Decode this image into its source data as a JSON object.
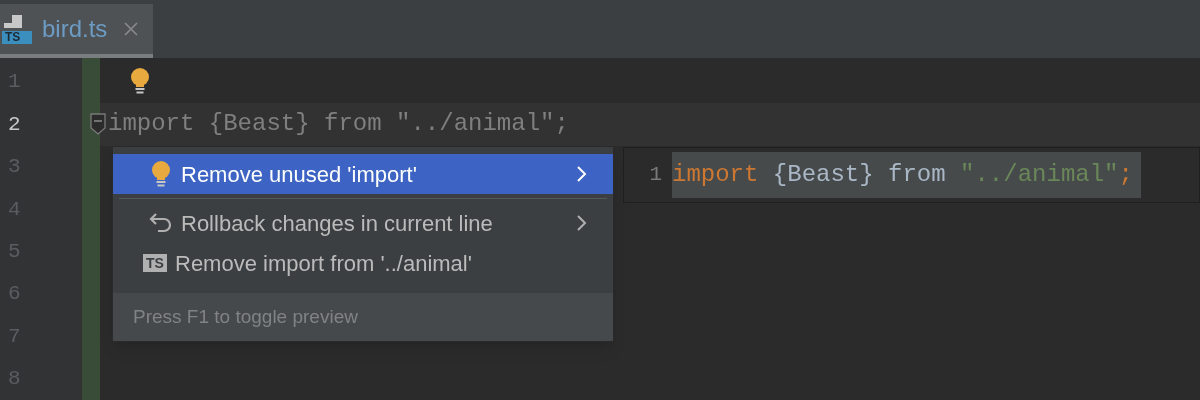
{
  "tabs": [
    {
      "label": "bird.ts",
      "badge": "TS",
      "selected": true
    }
  ],
  "gutter": {
    "line_numbers": [
      {
        "text": "1",
        "current": false
      },
      {
        "text": "2",
        "current": true
      },
      {
        "text": "3",
        "current": false
      },
      {
        "text": "4",
        "current": false
      },
      {
        "text": "5",
        "current": false
      },
      {
        "text": "6",
        "current": false
      },
      {
        "text": "7",
        "current": false
      },
      {
        "text": "8",
        "current": false
      }
    ]
  },
  "current_line": {
    "text": "import {Beast} from \"../animal\";",
    "unused": true
  },
  "intention_menu": {
    "items": [
      {
        "label": "Remove unused 'import'",
        "kind": "fix",
        "submenu": true,
        "selected": true
      },
      {
        "label": "Rollback changes in current line",
        "kind": "rollback",
        "submenu": true,
        "selected": false
      },
      {
        "label": "Remove import from '../animal'",
        "kind": "language",
        "badge": "TS",
        "submenu": false,
        "selected": false
      }
    ],
    "footer": "Press F1 to toggle preview"
  },
  "preview": {
    "line_number": "1",
    "tokens": [
      {
        "text": "import",
        "kind": "keyword"
      },
      {
        "text": " {Beast} from ",
        "kind": "plain"
      },
      {
        "text": "\"../animal\"",
        "kind": "string"
      },
      {
        "text": ";",
        "kind": "keyword"
      }
    ]
  }
}
